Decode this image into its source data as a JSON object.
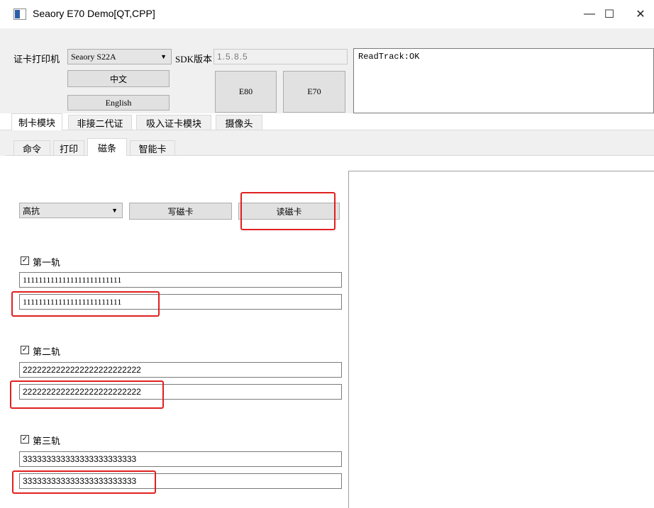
{
  "window": {
    "title": "Seaory E70 Demo[QT,CPP]",
    "controls": {
      "minimize": "—",
      "maximize": "☐",
      "close": "✕"
    }
  },
  "top": {
    "printer_label": "证卡打印机",
    "printer_value": "Seaory S22A",
    "sdk_label": "SDK版本",
    "sdk_value": "1.5.8.5",
    "btn_chinese": "中文",
    "btn_english": "English",
    "btn_e80": "E80",
    "btn_e70": "E70",
    "log_text": "ReadTrack:OK"
  },
  "main_tabs": [
    "制卡模块",
    "非接二代证",
    "吸入证卡模块",
    "摄像头"
  ],
  "sub_tabs": [
    "命令",
    "打印",
    "磁条",
    "智能卡"
  ],
  "magstripe": {
    "coercivity_value": "高抗",
    "write_button": "写磁卡",
    "read_button": "读磁卡",
    "tracks": [
      {
        "label": "第一轨",
        "checked": true,
        "write_value": "1111111111111111111111111",
        "read_value": "1111111111111111111111111"
      },
      {
        "label": "第二轨",
        "checked": true,
        "write_value": "2222222222222222222222222",
        "read_value": "2222222222222222222222222"
      },
      {
        "label": "第三轨",
        "checked": true,
        "write_value": "333333333333333333333333",
        "read_value": "333333333333333333333333"
      }
    ]
  },
  "colors": {
    "highlight": "#e02020",
    "button_bg": "#e1e1e1",
    "panel_bg": "#f0f0f0"
  },
  "icons": {
    "check": "✓",
    "dropdown": "▼"
  }
}
